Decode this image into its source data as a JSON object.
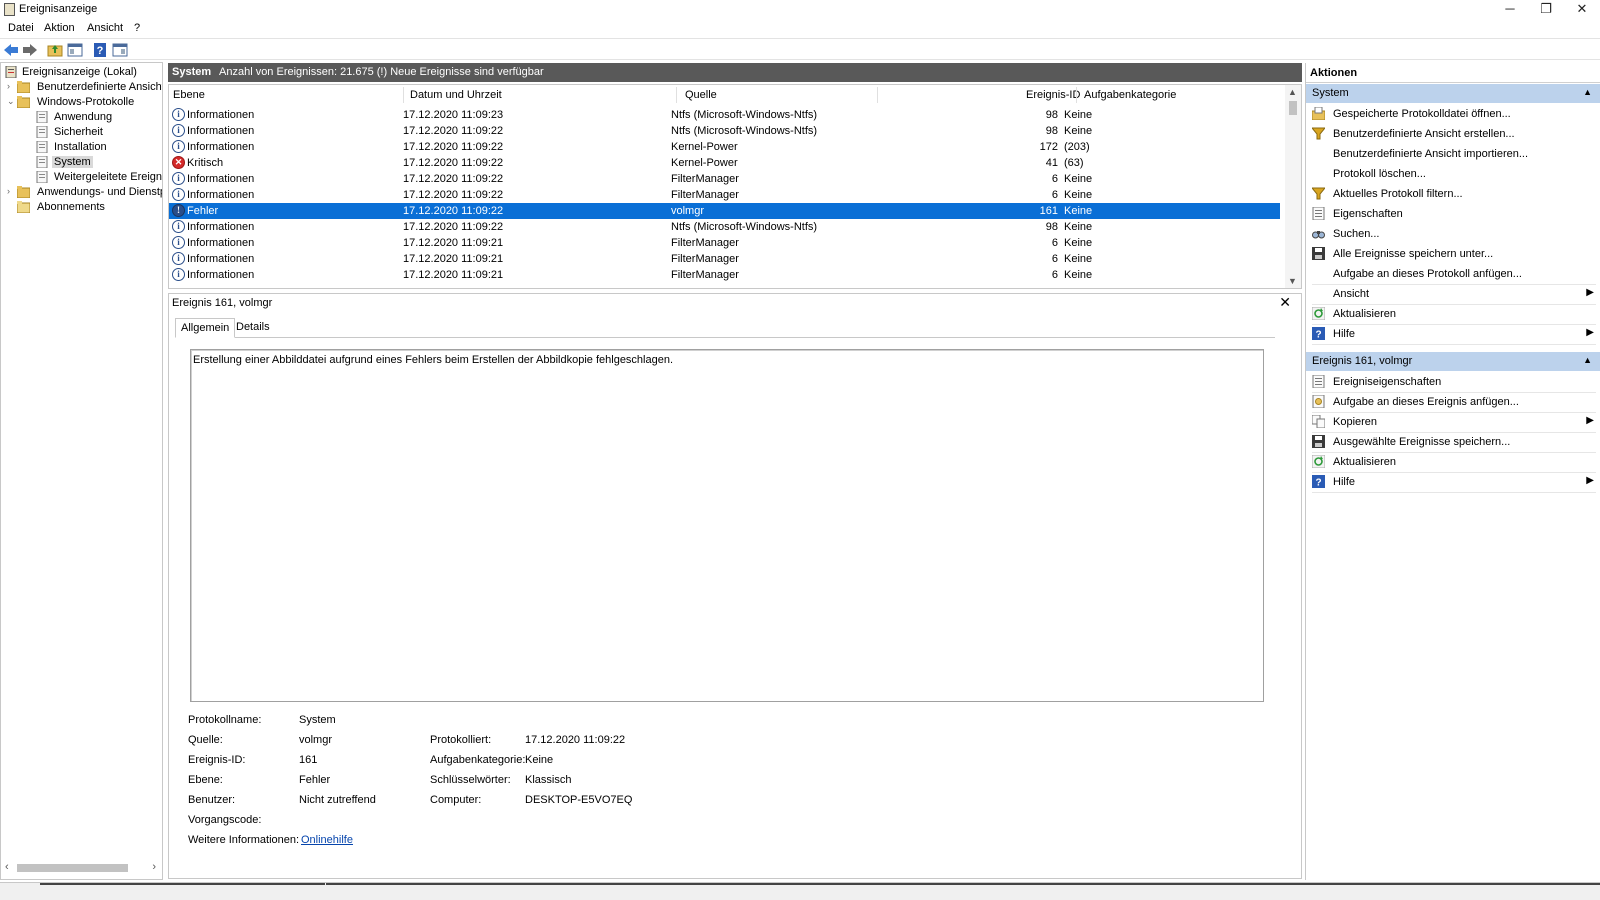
{
  "window": {
    "title": "Ereignisanzeige",
    "minimize": "─",
    "restore": "❐",
    "close": "✕"
  },
  "menu": [
    "Datei",
    "Aktion",
    "Ansicht",
    "?"
  ],
  "tree": {
    "items": [
      {
        "label": "Ereignisanzeige (Lokal)",
        "icon": "event-viewer-icon"
      },
      {
        "label": "Benutzerdefinierte Ansichten",
        "icon": "folder-icon"
      },
      {
        "label": "Windows-Protokolle",
        "icon": "folder-icon"
      },
      {
        "label": "Anwendung",
        "icon": "log-icon"
      },
      {
        "label": "Sicherheit",
        "icon": "log-icon"
      },
      {
        "label": "Installation",
        "icon": "log-icon"
      },
      {
        "label": "System",
        "icon": "log-icon"
      },
      {
        "label": "Weitergeleitete Ereignisse",
        "icon": "log-icon"
      },
      {
        "label": "Anwendungs- und Dienstprotokolle",
        "icon": "folder-icon"
      },
      {
        "label": "Abonnements",
        "icon": "subscription-icon"
      }
    ]
  },
  "list": {
    "header_title": "System",
    "header_info": "Anzahl von Ereignissen: 21.675 (!) Neue Ereignisse sind verfügbar",
    "columns": [
      "Ebene",
      "Datum und Uhrzeit",
      "Quelle",
      "Ereignis-ID",
      "Aufgabenkategorie"
    ],
    "rows": [
      {
        "level": "Informationen",
        "type": "info",
        "date": "17.12.2020 11:09:23",
        "source": "Ntfs (Microsoft-Windows-Ntfs)",
        "id": "98",
        "category": "Keine"
      },
      {
        "level": "Informationen",
        "type": "info",
        "date": "17.12.2020 11:09:22",
        "source": "Ntfs (Microsoft-Windows-Ntfs)",
        "id": "98",
        "category": "Keine"
      },
      {
        "level": "Informationen",
        "type": "info",
        "date": "17.12.2020 11:09:22",
        "source": "Kernel-Power",
        "id": "172",
        "category": "(203)"
      },
      {
        "level": "Kritisch",
        "type": "crit",
        "date": "17.12.2020 11:09:22",
        "source": "Kernel-Power",
        "id": "41",
        "category": "(63)"
      },
      {
        "level": "Informationen",
        "type": "info",
        "date": "17.12.2020 11:09:22",
        "source": "FilterManager",
        "id": "6",
        "category": "Keine"
      },
      {
        "level": "Informationen",
        "type": "info",
        "date": "17.12.2020 11:09:22",
        "source": "FilterManager",
        "id": "6",
        "category": "Keine"
      },
      {
        "level": "Fehler",
        "type": "err",
        "date": "17.12.2020 11:09:22",
        "source": "volmgr",
        "id": "161",
        "category": "Keine",
        "selected": true
      },
      {
        "level": "Informationen",
        "type": "info",
        "date": "17.12.2020 11:09:22",
        "source": "Ntfs (Microsoft-Windows-Ntfs)",
        "id": "98",
        "category": "Keine"
      },
      {
        "level": "Informationen",
        "type": "info",
        "date": "17.12.2020 11:09:21",
        "source": "FilterManager",
        "id": "6",
        "category": "Keine"
      },
      {
        "level": "Informationen",
        "type": "info",
        "date": "17.12.2020 11:09:21",
        "source": "FilterManager",
        "id": "6",
        "category": "Keine"
      },
      {
        "level": "Informationen",
        "type": "info",
        "date": "17.12.2020 11:09:21",
        "source": "FilterManager",
        "id": "6",
        "category": "Keine"
      }
    ]
  },
  "detail": {
    "title": "Ereignis 161, volmgr",
    "close": "✕",
    "tabs": [
      "Allgemein",
      "Details"
    ],
    "message": "Erstellung einer Abbilddatei aufgrund eines Fehlers beim Erstellen der Abbildkopie fehlgeschlagen.",
    "props_left": [
      {
        "label": "Protokollname:",
        "value": "System"
      },
      {
        "label": "Quelle:",
        "value": "volmgr"
      },
      {
        "label": "Ereignis-ID:",
        "value": "161"
      },
      {
        "label": "Ebene:",
        "value": "Fehler"
      },
      {
        "label": "Benutzer:",
        "value": "Nicht zutreffend"
      },
      {
        "label": "Vorgangscode:",
        "value": ""
      },
      {
        "label": "Weitere Informationen:",
        "value": "Onlinehilfe"
      }
    ],
    "props_right": [
      {
        "label": "Protokolliert:",
        "value": "17.12.2020 11:09:22"
      },
      {
        "label": "Aufgabenkategorie:",
        "value": "Keine"
      },
      {
        "label": "Schlüsselwörter:",
        "value": "Klassisch"
      },
      {
        "label": "Computer:",
        "value": "DESKTOP-E5VO7EQ"
      }
    ]
  },
  "actions": {
    "title": "Aktionen",
    "section1": "System",
    "items1": [
      {
        "label": "Gespeicherte Protokolldatei öffnen...",
        "icon": "open-log-icon"
      },
      {
        "label": "Benutzerdefinierte Ansicht erstellen...",
        "icon": "filter-icon"
      },
      {
        "label": "Benutzerdefinierte Ansicht importieren...",
        "icon": ""
      },
      {
        "label": "Protokoll löschen...",
        "icon": ""
      },
      {
        "label": "Aktuelles Protokoll filtern...",
        "icon": "filter-icon"
      },
      {
        "label": "Eigenschaften",
        "icon": "properties-icon"
      },
      {
        "label": "Suchen...",
        "icon": "find-icon"
      },
      {
        "label": "Alle Ereignisse speichern unter...",
        "icon": "save-icon"
      },
      {
        "label": "Aufgabe an dieses Protokoll anfügen...",
        "icon": ""
      },
      {
        "label": "Ansicht",
        "icon": "",
        "submenu": true
      },
      {
        "label": "Aktualisieren",
        "icon": "refresh-icon"
      },
      {
        "label": "Hilfe",
        "icon": "help-icon",
        "submenu": true
      }
    ],
    "section2": "Ereignis 161, volmgr",
    "items2": [
      {
        "label": "Ereigniseigenschaften",
        "icon": "properties-icon"
      },
      {
        "label": "Aufgabe an dieses Ereignis anfügen...",
        "icon": "task-icon"
      },
      {
        "label": "Kopieren",
        "icon": "copy-icon",
        "submenu": true
      },
      {
        "label": "Ausgewählte Ereignisse speichern...",
        "icon": "save-icon"
      },
      {
        "label": "Aktualisieren",
        "icon": "refresh-icon"
      },
      {
        "label": "Hilfe",
        "icon": "help-icon",
        "submenu": true
      }
    ]
  },
  "colors": {
    "selection": "#0a6fd6",
    "section_header": "#bcd2ec",
    "list_header_bar": "#595959"
  }
}
